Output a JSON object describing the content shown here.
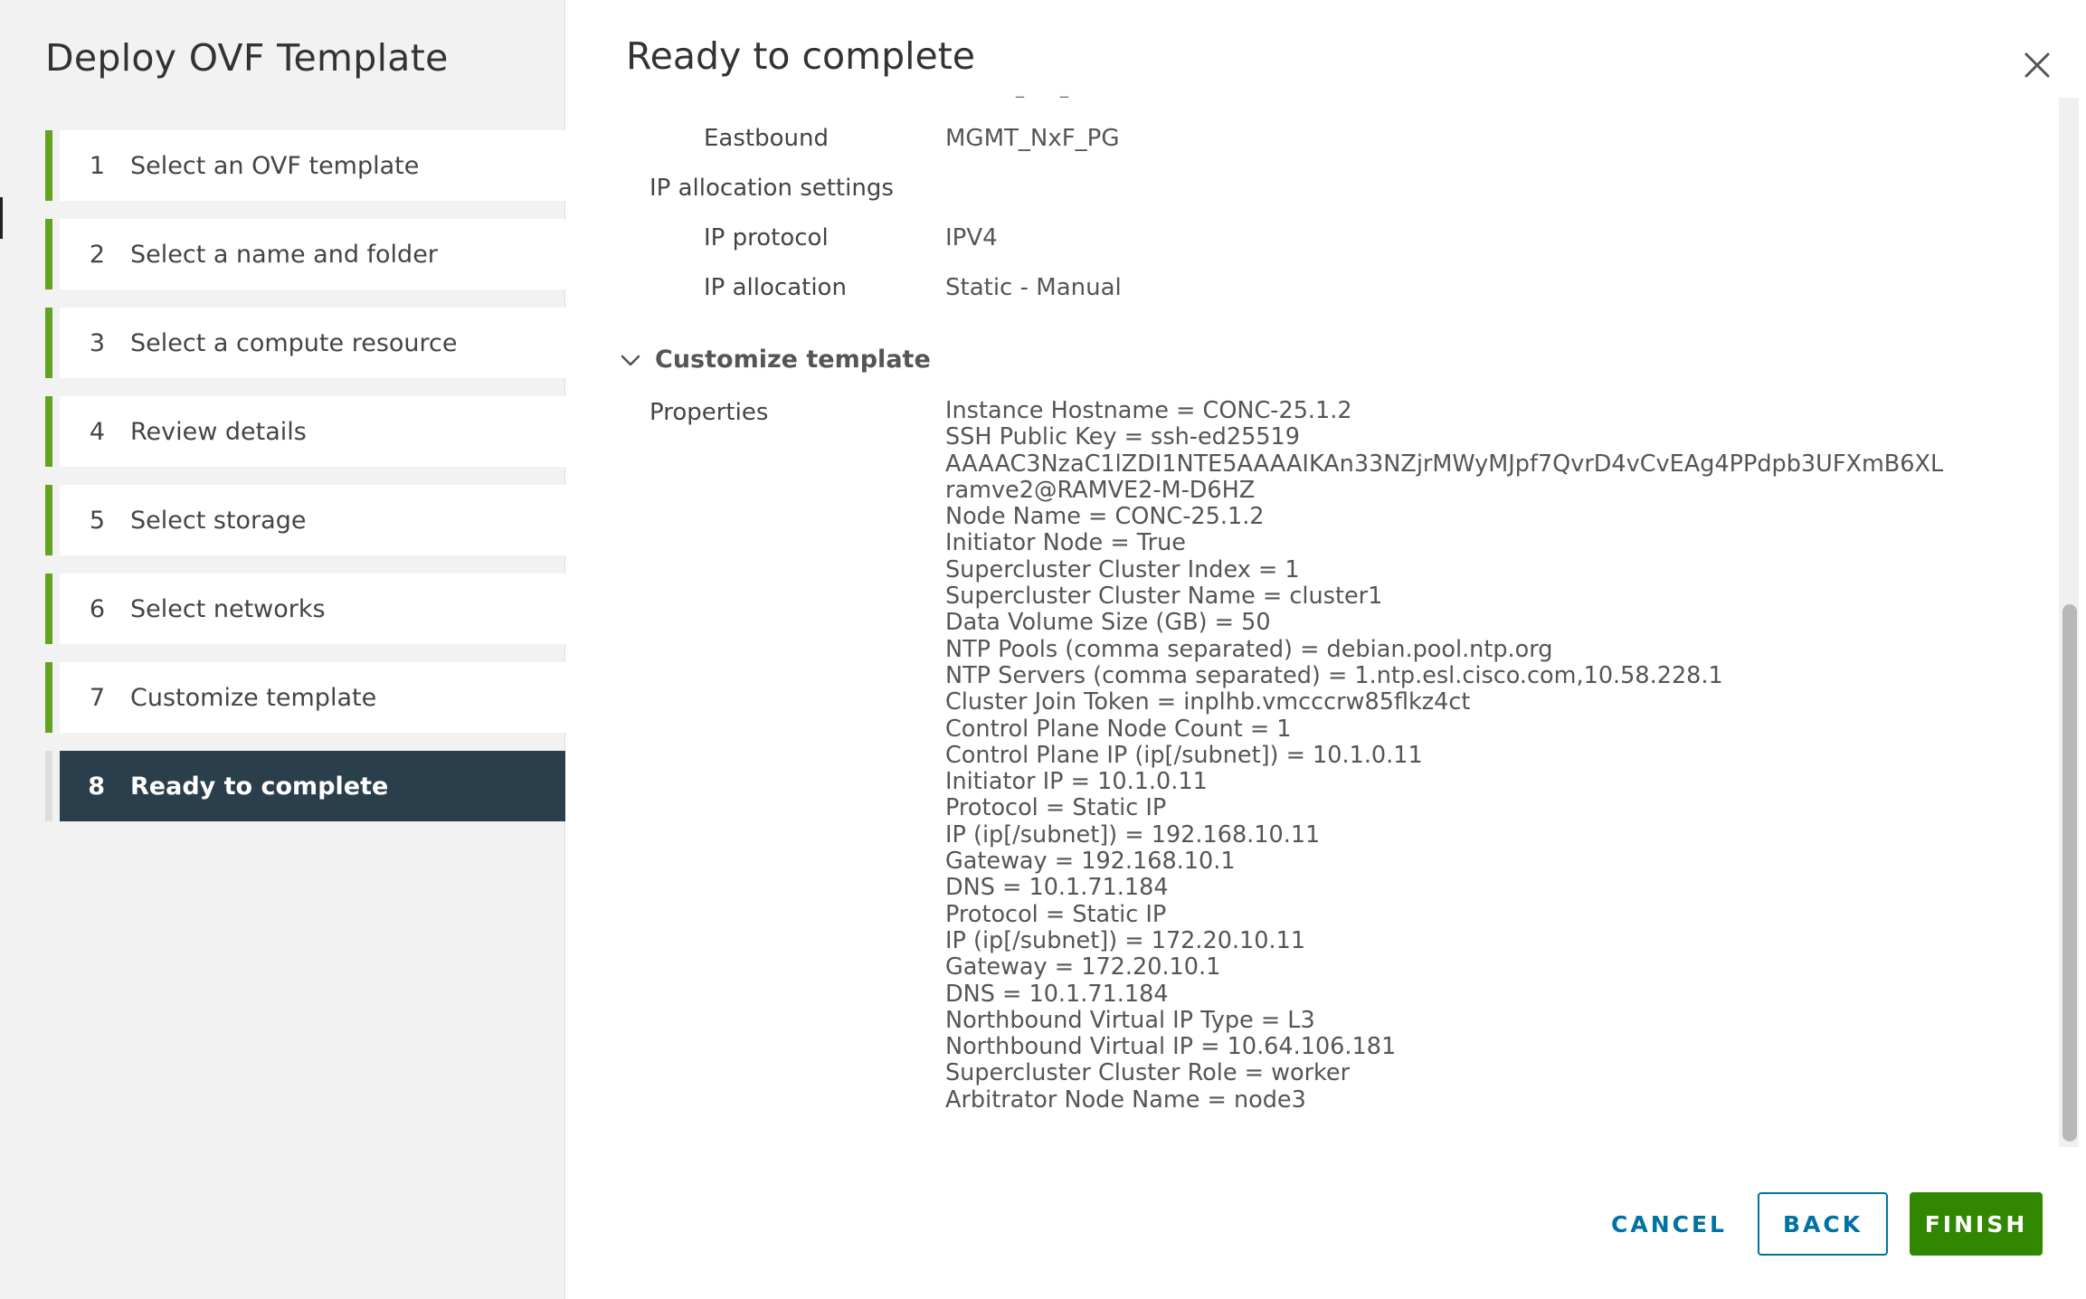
{
  "wizard": {
    "title": "Deploy OVF Template",
    "steps": [
      {
        "num": "1",
        "label": "Select an OVF template"
      },
      {
        "num": "2",
        "label": "Select a name and folder"
      },
      {
        "num": "3",
        "label": "Select a compute resource"
      },
      {
        "num": "4",
        "label": "Review details"
      },
      {
        "num": "5",
        "label": "Select storage"
      },
      {
        "num": "6",
        "label": "Select networks"
      },
      {
        "num": "7",
        "label": "Customize template"
      },
      {
        "num": "8",
        "label": "Ready to complete"
      }
    ],
    "active_step": 8
  },
  "content": {
    "title": "Ready to complete",
    "networks": {
      "eastbound_label": "Eastbound",
      "eastbound_value": "MGMT_NxF_PG"
    },
    "ip_allocation": {
      "section_label": "IP allocation settings",
      "protocol_label": "IP protocol",
      "protocol_value": "IPV4",
      "allocation_label": "IP allocation",
      "allocation_value": "Static - Manual"
    },
    "customize_template": {
      "section_title": "Customize template",
      "properties_label": "Properties",
      "properties": [
        "Instance Hostname = CONC-25.1.2",
        "SSH Public Key = ssh-ed25519",
        "AAAAC3NzaC1lZDI1NTE5AAAAIKAn33NZjrMWyMJpf7QvrD4vCvEAg4PPdpb3UFXmB6XL",
        "ramve2@RAMVE2-M-D6HZ",
        "Node Name = CONC-25.1.2",
        "Initiator Node = True",
        "Supercluster Cluster Index = 1",
        "Supercluster Cluster Name = cluster1",
        "Data Volume Size (GB) = 50",
        "NTP Pools (comma separated) = debian.pool.ntp.org",
        "NTP Servers (comma separated) = 1.ntp.esl.cisco.com,10.58.228.1",
        "Cluster Join Token = inplhb.vmcccrw85flkz4ct",
        "Control Plane Node Count = 1",
        "Control Plane IP (ip[/subnet]) = 10.1.0.11",
        "Initiator IP = 10.1.0.11",
        "Protocol = Static IP",
        "IP (ip[/subnet]) = 192.168.10.11",
        "Gateway = 192.168.10.1",
        "DNS = 10.1.71.184",
        "Protocol = Static IP",
        "IP (ip[/subnet]) = 172.20.10.11",
        "Gateway = 172.20.10.1",
        "DNS = 10.1.71.184",
        "Northbound Virtual IP Type = L3",
        "Northbound Virtual IP = 10.64.106.181",
        "Supercluster Cluster Role = worker",
        "Arbitrator Node Name = node3"
      ]
    }
  },
  "footer": {
    "cancel_label": "CANCEL",
    "back_label": "BACK",
    "finish_label": "FINISH"
  },
  "icons": {
    "close": "close-icon",
    "chevron": "chevron-down-icon"
  },
  "colors": {
    "step_accent": "#62a420",
    "active_step_bg": "#2b3e4c",
    "link_blue": "#0072a3",
    "finish_green": "#318700"
  }
}
